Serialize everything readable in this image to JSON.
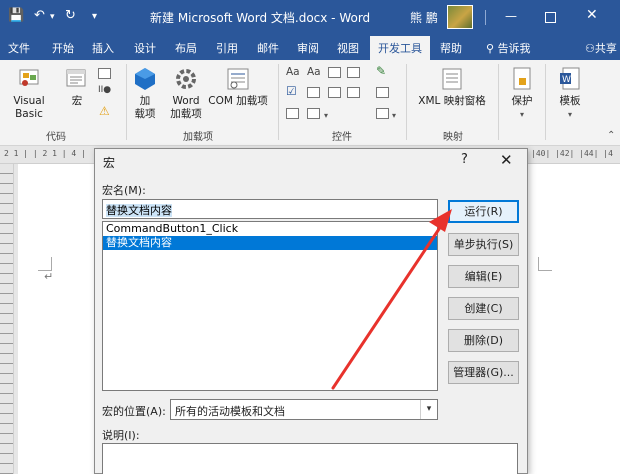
{
  "titlebar": {
    "save_icon": "save-icon",
    "undo_icon": "undo-icon",
    "redo_icon": "redo-icon",
    "title": "新建 Microsoft Word 文档.docx  -  Word",
    "user": "熊 鹏",
    "restore_label": "▭"
  },
  "tabs": [
    {
      "label": "文件"
    },
    {
      "label": "开始"
    },
    {
      "label": "插入"
    },
    {
      "label": "设计"
    },
    {
      "label": "布局"
    },
    {
      "label": "引用"
    },
    {
      "label": "邮件"
    },
    {
      "label": "审阅"
    },
    {
      "label": "视图"
    },
    {
      "label": "开发工具",
      "active": true
    },
    {
      "label": "帮助"
    }
  ],
  "tellme": "告诉我",
  "share": "共享",
  "ribbon": {
    "code": {
      "label": "代码",
      "visual_basic": "Visual Basic",
      "macro": "宏"
    },
    "addins": {
      "label": "加载项",
      "addin_line1": "加",
      "addin_line2": "载项",
      "word_addin_line1": "Word",
      "word_addin_line2": "加载项",
      "com_addin": "COM 加载项"
    },
    "controls": {
      "label": "控件"
    },
    "mapping": {
      "label": "映射",
      "xml_pane": "XML 映射窗格"
    },
    "protect": {
      "label": "保护"
    },
    "template": {
      "label": "模板"
    }
  },
  "ruler": {
    "left_text": "2   1  |   | 2 1  | 4 |",
    "right_text": "|40|  |42|  |44|  |4"
  },
  "dialog": {
    "title": "宏",
    "help": "?",
    "close": "✕",
    "macro_name_label": "宏名(M):",
    "macro_name_value": "替换文档内容",
    "macros": [
      {
        "name": "CommandButton1_Click",
        "selected": false
      },
      {
        "name": "替换文档内容",
        "selected": true
      }
    ],
    "buttons": {
      "run": "运行(R)",
      "step": "单步执行(S)",
      "edit": "编辑(E)",
      "create": "创建(C)",
      "delete": "删除(D)",
      "organizer": "管理器(G)..."
    },
    "location_label": "宏的位置(A):",
    "location_value": "所有的活动模板和文档",
    "description_label": "说明(I):"
  },
  "annotation": {
    "arrow_color": "#e8322c"
  }
}
